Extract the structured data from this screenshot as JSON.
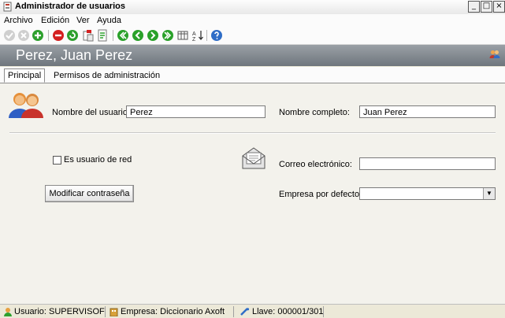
{
  "window": {
    "title": "Administrador de usuarios",
    "controls": [
      "_",
      "□",
      "×"
    ]
  },
  "menu": [
    "Archivo",
    "Edición",
    "Ver",
    "Ayuda"
  ],
  "toolbar_icons": [
    "accept-icon-disabled",
    "cancel-icon-disabled",
    "add-icon",
    "delete-icon",
    "refresh-icon",
    "paste-icon",
    "document-icon",
    "first-record-icon",
    "previous-record-icon",
    "next-record-icon",
    "last-record-icon",
    "grid-icon",
    "sort-icon",
    "help-icon"
  ],
  "header": {
    "record_title": "Perez, Juan Perez"
  },
  "tabs": [
    {
      "label": "Principal",
      "active": true
    },
    {
      "label": "Permisos de administración",
      "active": false
    }
  ],
  "form": {
    "username_label": "Nombre del usuario:",
    "username_value": "Perez",
    "fullname_label": "Nombre completo:",
    "fullname_value": "Juan Perez",
    "network_user_label": "Es usuario de red",
    "network_user_checked": false,
    "email_label": "Correo electrónico:",
    "email_value": "",
    "change_password_label": "Modificar contraseña",
    "company_label": "Empresa por defecto:",
    "company_value": ""
  },
  "status": {
    "user": "Usuario: SUPERVISOF",
    "company": "Empresa: Diccionario Axoft",
    "key": "Llave: 000001/301"
  },
  "colors": {
    "header_bg": "#7c838a",
    "add_green": "#2ea02e",
    "delete_red": "#d42020",
    "nav_green": "#2aa12a",
    "help_blue": "#2f6dc7"
  }
}
